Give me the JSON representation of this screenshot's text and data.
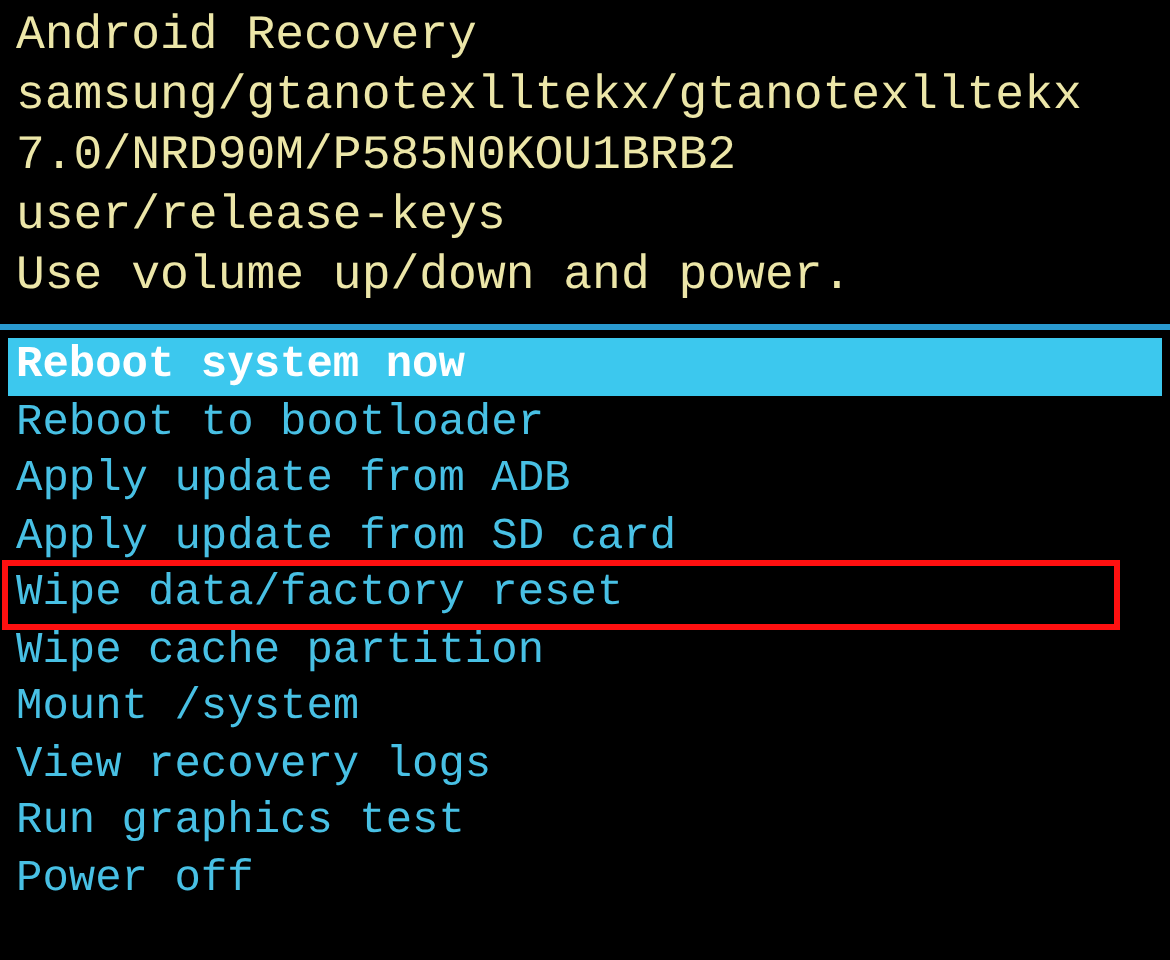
{
  "header_lines": [
    "Android Recovery",
    "samsung/gtanotexlltekx/gtanotexlltekx",
    "7.0/NRD90M/P585N0KOU1BRB2",
    "user/release-keys",
    "Use volume up/down and power."
  ],
  "menu": [
    {
      "label": "Reboot system now",
      "selected": true,
      "highlighted": false
    },
    {
      "label": "Reboot to bootloader",
      "selected": false,
      "highlighted": false
    },
    {
      "label": "Apply update from ADB",
      "selected": false,
      "highlighted": false
    },
    {
      "label": "Apply update from SD card",
      "selected": false,
      "highlighted": false
    },
    {
      "label": "Wipe data/factory reset",
      "selected": false,
      "highlighted": true
    },
    {
      "label": "Wipe cache partition",
      "selected": false,
      "highlighted": false
    },
    {
      "label": "Mount /system",
      "selected": false,
      "highlighted": false
    },
    {
      "label": "View recovery logs",
      "selected": false,
      "highlighted": false
    },
    {
      "label": "Run graphics test",
      "selected": false,
      "highlighted": false
    },
    {
      "label": "Power off",
      "selected": false,
      "highlighted": false
    }
  ]
}
